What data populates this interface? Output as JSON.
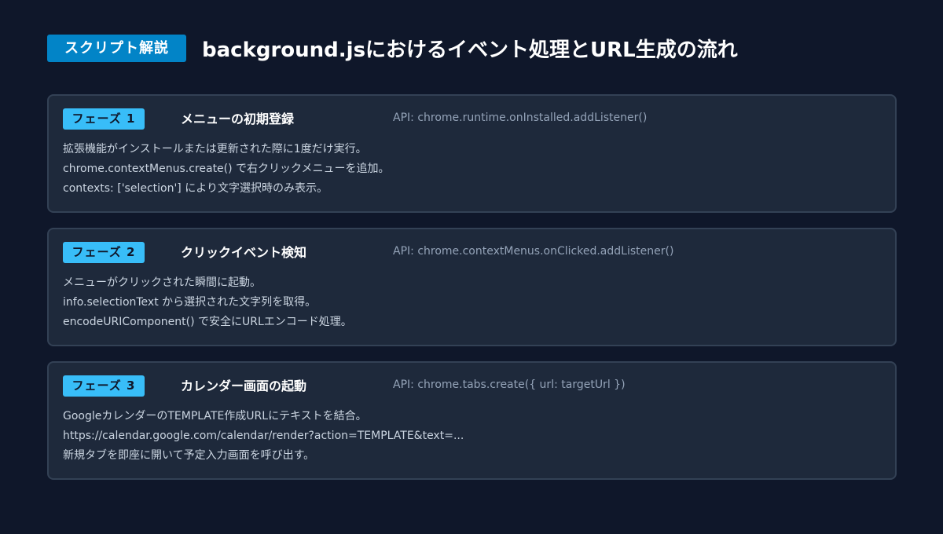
{
  "header": {
    "tag": "スクリプト解説",
    "title": "background.jsにおけるイベント処理とURL生成の流れ"
  },
  "phases": [
    {
      "badge": "フェーズ 1",
      "title": "メニューの初期登録",
      "api": "API: chrome.runtime.onInstalled.addListener()",
      "lines": [
        "拡張機能がインストールまたは更新された際に1度だけ実行。",
        "chrome.contextMenus.create() で右クリックメニューを追加。",
        "contexts: ['selection'] により文字選択時のみ表示。"
      ]
    },
    {
      "badge": "フェーズ 2",
      "title": "クリックイベント検知",
      "api": "API: chrome.contextMenus.onClicked.addListener()",
      "lines": [
        "メニューがクリックされた瞬間に起動。",
        "info.selectionText から選択された文字列を取得。",
        "encodeURIComponent() で安全にURLエンコード処理。"
      ]
    },
    {
      "badge": "フェーズ 3",
      "title": "カレンダー画面の起動",
      "api": "API: chrome.tabs.create({ url: targetUrl })",
      "lines": [
        "GoogleカレンダーのTEMPLATE作成URLにテキストを結合。",
        "https://calendar.google.com/calendar/render?action=TEMPLATE&text=...",
        "新規タブを即座に開いて予定入力画面を呼び出す。"
      ]
    }
  ]
}
